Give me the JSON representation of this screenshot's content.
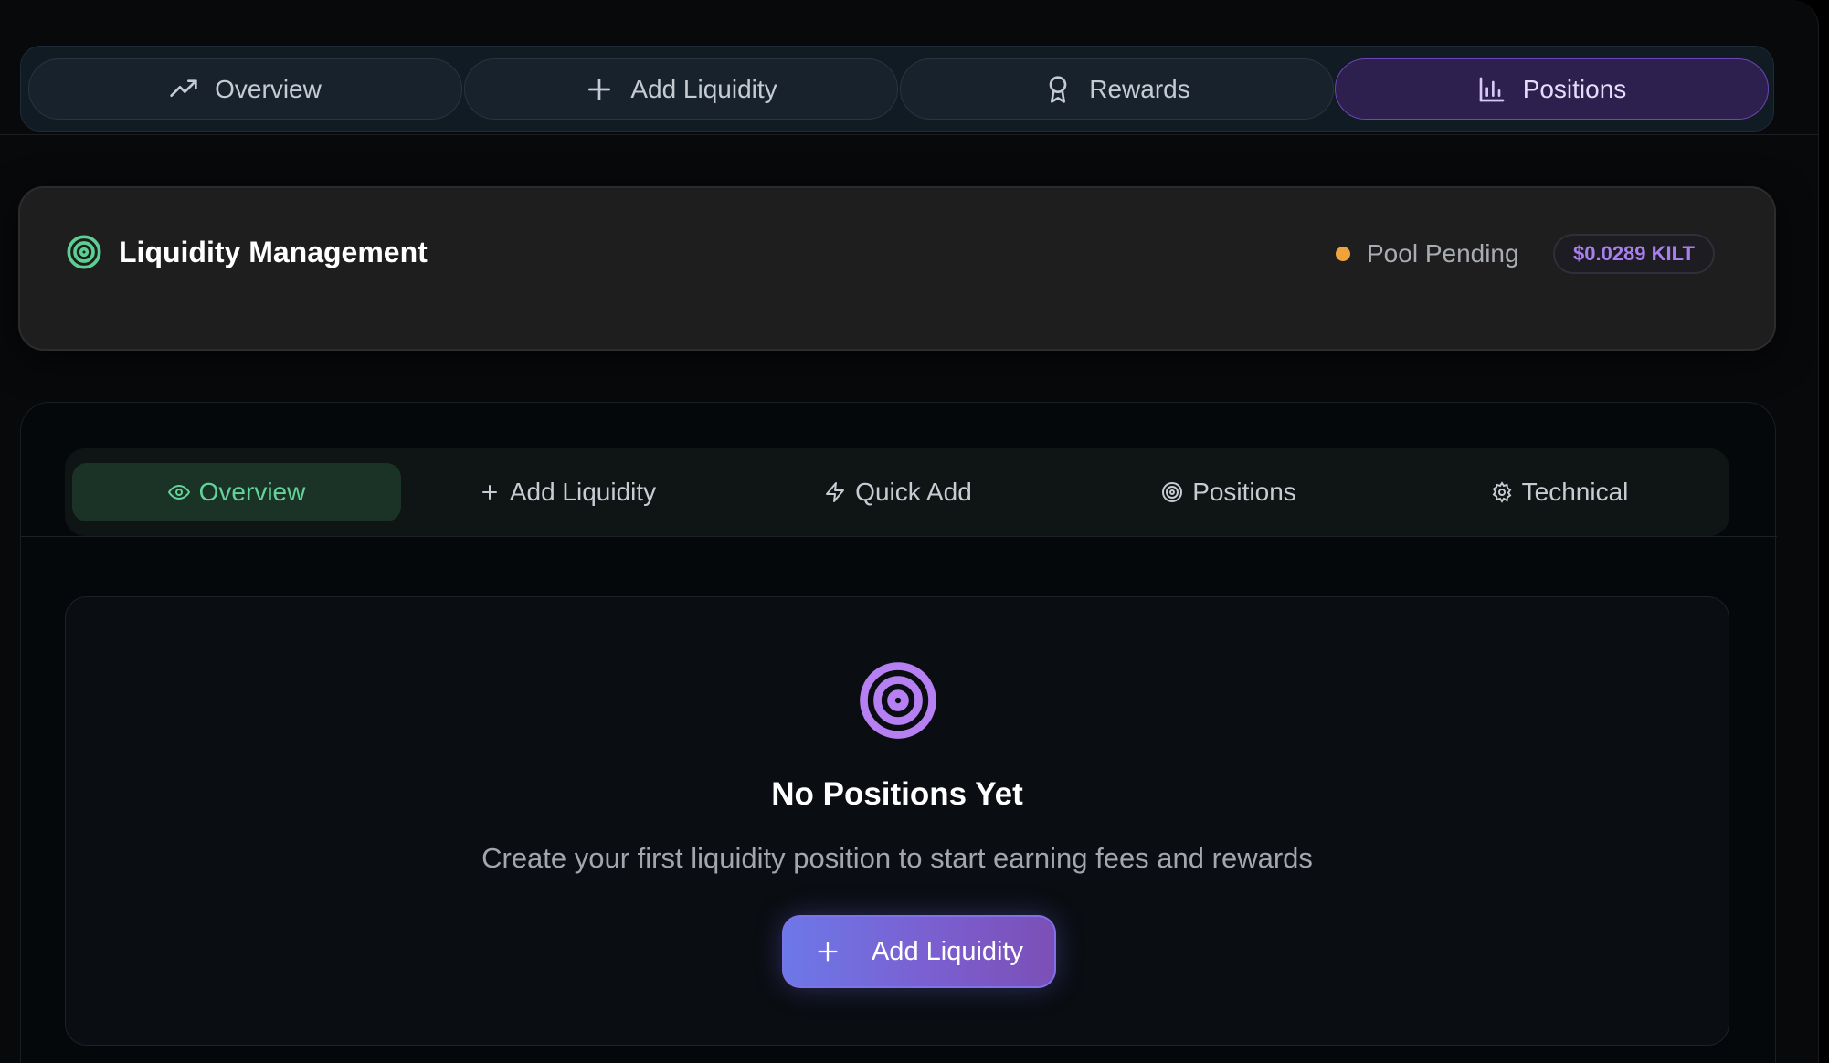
{
  "top_nav": {
    "tabs": [
      {
        "label": "Overview",
        "icon": "trending-up-icon"
      },
      {
        "label": "Add Liquidity",
        "icon": "plus-icon"
      },
      {
        "label": "Rewards",
        "icon": "award-icon"
      },
      {
        "label": "Positions",
        "icon": "bar-chart-icon",
        "active": true
      }
    ]
  },
  "header": {
    "title": "Liquidity Management",
    "title_icon": "target-icon",
    "status_label": "Pool Pending",
    "status_color": "#f0a33a",
    "price": "$0.0289 KILT"
  },
  "sub_nav": {
    "tabs": [
      {
        "label": "Overview",
        "icon": "eye-icon",
        "active": true
      },
      {
        "label": "Add Liquidity",
        "icon": "plus-icon"
      },
      {
        "label": "Quick Add",
        "icon": "zap-icon"
      },
      {
        "label": "Positions",
        "icon": "target-icon"
      },
      {
        "label": "Technical",
        "icon": "gear-icon"
      }
    ]
  },
  "empty_state": {
    "icon": "target-icon",
    "title": "No Positions Yet",
    "description": "Create your first liquidity position to start earning fees and rewards",
    "button_label": "Add Liquidity",
    "button_icon": "plus-icon"
  },
  "colors": {
    "accent_purple": "#a97ff0",
    "accent_green": "#63d39a",
    "icon_purple": "#b680f2"
  }
}
